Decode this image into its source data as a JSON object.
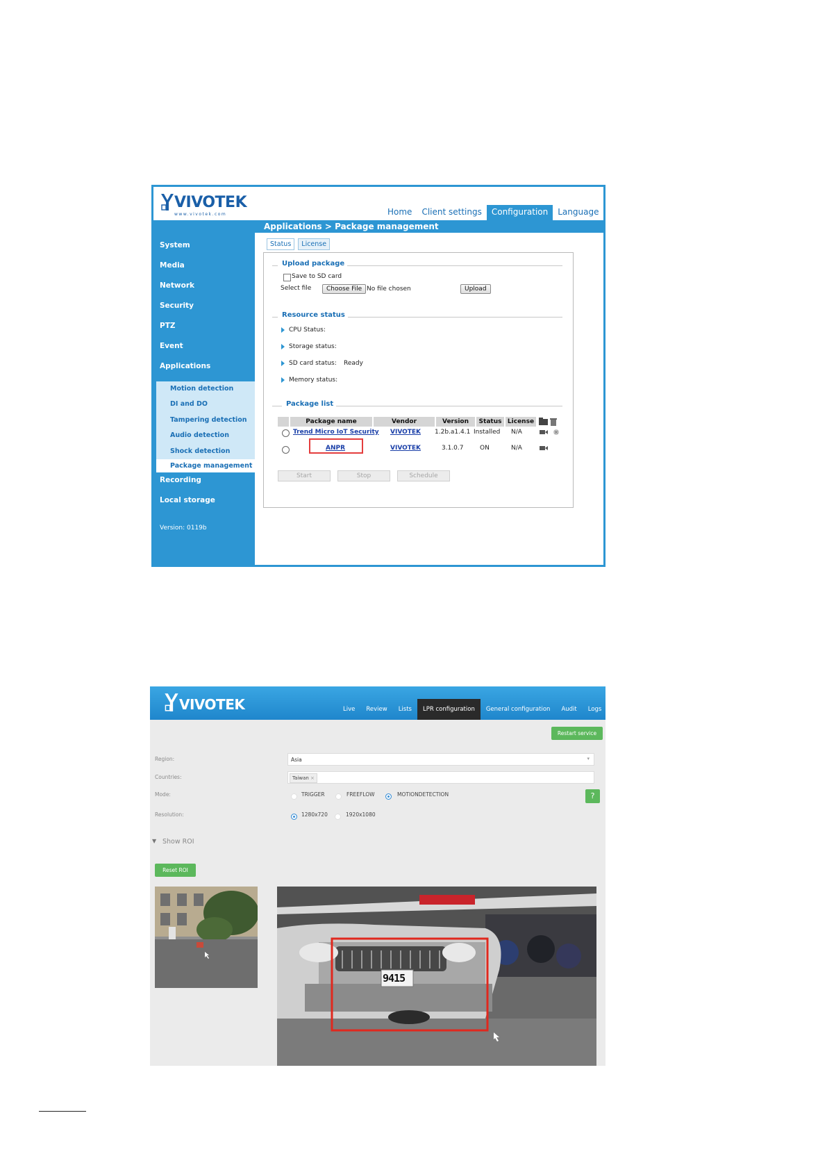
{
  "shot1": {
    "logo": {
      "brand": "VIVOTEK",
      "url": "www.vivotek.com"
    },
    "top_nav": [
      {
        "label": "Home",
        "active": false
      },
      {
        "label": "Client settings",
        "active": false
      },
      {
        "label": "Configuration",
        "active": true
      },
      {
        "label": "Language",
        "active": false
      }
    ],
    "breadcrumb": "Applications  > Package management",
    "sidebar": {
      "items": [
        "System",
        "Media",
        "Network",
        "Security",
        "PTZ",
        "Event",
        "Applications"
      ],
      "sub_items": [
        "Motion detection",
        "DI and DO",
        "Tampering detection",
        "Audio detection",
        "Shock detection",
        "Package management"
      ],
      "active_sub": "Package management",
      "bottom_items": [
        "Recording",
        "Local storage"
      ],
      "version": "Version: 0119b"
    },
    "tabs": [
      "Status",
      "License"
    ],
    "upload": {
      "legend": "Upload package",
      "save_sd_label": "Save to SD card",
      "select_file_label": "Select file",
      "choose_file_button": "Choose File",
      "no_file_text": "No file chosen",
      "upload_button": "Upload"
    },
    "resource": {
      "legend": "Resource status",
      "items": [
        {
          "label": "CPU Status:",
          "value": ""
        },
        {
          "label": "Storage status:",
          "value": ""
        },
        {
          "label": "SD card status:",
          "value": "Ready"
        },
        {
          "label": "Memory status:",
          "value": ""
        }
      ]
    },
    "packages": {
      "legend": "Package list",
      "headers": [
        "Package name",
        "Vendor",
        "Version",
        "Status",
        "License"
      ],
      "rows": [
        {
          "name": "Trend Micro IoT Security",
          "vendor": "VIVOTEK",
          "version": "1.2b.a1.4.1",
          "status": "Installed",
          "license": "N/A"
        },
        {
          "name": "ANPR",
          "vendor": "VIVOTEK",
          "version": "3.1.0.7",
          "status": "ON",
          "license": "N/A"
        }
      ],
      "buttons": [
        "Start",
        "Stop",
        "Schedule"
      ]
    },
    "colors": {
      "accent": "#2d96d3",
      "highlight": "#e43d3d"
    }
  },
  "shot2": {
    "logo": "VIVOTEK",
    "nav": [
      {
        "label": "Live",
        "active": false
      },
      {
        "label": "Review",
        "active": false
      },
      {
        "label": "Lists",
        "active": false
      },
      {
        "label": "LPR configuration",
        "active": true
      },
      {
        "label": "General configuration",
        "active": false
      },
      {
        "label": "Audit",
        "active": false
      },
      {
        "label": "Logs",
        "active": false
      }
    ],
    "restart_button": "Restart service",
    "region_label": "Region:",
    "region_value": "Asia",
    "countries_label": "Countries:",
    "countries_tag": "Taiwan",
    "mode_label": "Mode:",
    "mode_options": [
      "TRIGGER",
      "FREEFLOW",
      "MOTIONDETECTION"
    ],
    "mode_selected": "MOTIONDETECTION",
    "help_button": "?",
    "resolution_label": "Resolution:",
    "resolution_options": [
      "1280x720",
      "1920x1080"
    ],
    "resolution_selected": "1280x720",
    "show_roi": "Show ROI",
    "reset_roi_button": "Reset ROI",
    "plate_text": "9415",
    "colors": {
      "green": "#5cb85c",
      "nav_active": "#2a2a2a",
      "roi": "#e0281e"
    }
  }
}
